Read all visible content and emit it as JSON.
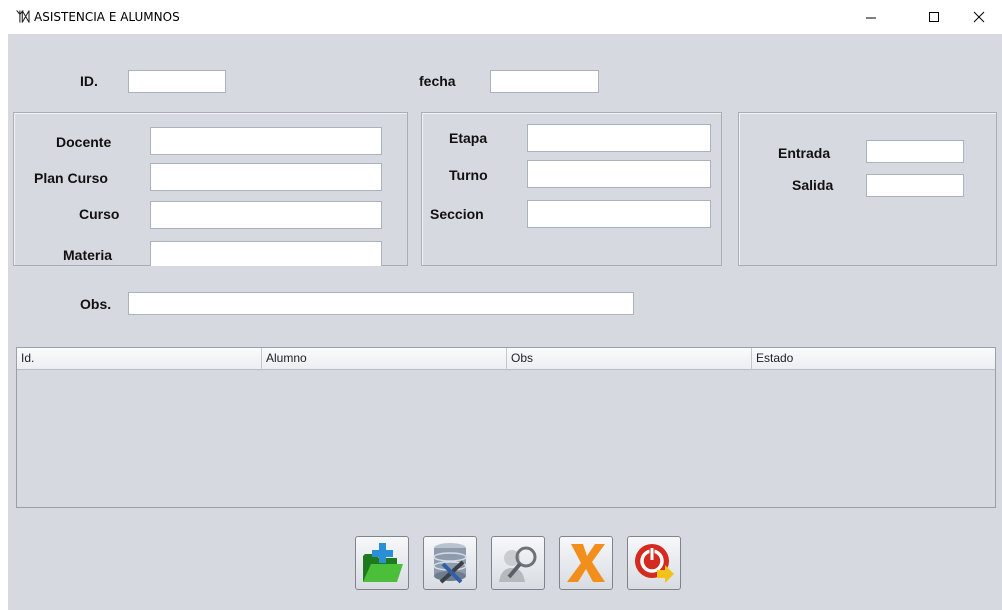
{
  "window": {
    "icon": "app-logo-icon",
    "title": "ASISTENCIA E ALUMNOS",
    "controls": [
      "minimize-icon",
      "maximize-icon",
      "close-icon"
    ]
  },
  "form": {
    "id_label": "ID.",
    "id_value": "",
    "fecha_label": "fecha",
    "fecha_value": "",
    "docente_label": "Docente",
    "docente_value": "",
    "plan_curso_label": "Plan Curso",
    "plan_curso_value": "",
    "curso_label": "Curso",
    "curso_value": "",
    "materia_label": "Materia",
    "materia_value": "",
    "etapa_label": "Etapa",
    "etapa_value": "",
    "turno_label": "Turno",
    "turno_value": "",
    "seccion_label": "Seccion",
    "seccion_value": "",
    "entrada_label": "Entrada",
    "entrada_value": "",
    "salida_label": "Salida",
    "salida_value": "",
    "obs_label": "Obs.",
    "obs_value": ""
  },
  "table": {
    "columns": [
      "Id.",
      "Alumno",
      "Obs",
      "Estado"
    ],
    "rows": []
  },
  "toolbar": {
    "buttons": [
      {
        "name": "new",
        "icon": "folder-add-icon",
        "color": "#2e9e2e"
      },
      {
        "name": "save",
        "icon": "database-tools-icon",
        "color": "#5a6f8a"
      },
      {
        "name": "search",
        "icon": "search-person-icon",
        "color": "#8a8f96"
      },
      {
        "name": "cancel",
        "icon": "x-cancel-icon",
        "color": "#f08c1e"
      },
      {
        "name": "exit",
        "icon": "power-exit-icon",
        "color": "#d0201c"
      }
    ]
  }
}
